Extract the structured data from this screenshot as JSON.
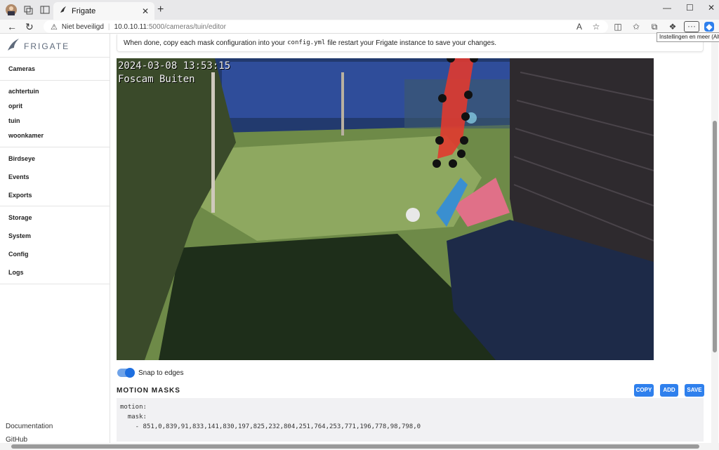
{
  "browser": {
    "tab_title": "Frigate",
    "url_warning": "Niet beveiligd",
    "url_host": "10.0.10.11",
    "url_path": ":5000/cameras/tuin/editor",
    "tooltip": "Instellingen en meer (Alt+F)"
  },
  "sidebar": {
    "brand": "FRIGATE",
    "cameras_label": "Cameras",
    "cameras": [
      "achtertuin",
      "oprit",
      "tuin",
      "woonkamer"
    ],
    "section2": [
      "Birdseye",
      "Events",
      "Exports"
    ],
    "section3": [
      "Storage",
      "System",
      "Config",
      "Logs"
    ],
    "footer": [
      "Documentation",
      "GitHub"
    ]
  },
  "main": {
    "notice_before": "When done, copy each mask configuration into your",
    "notice_code": "config.yml",
    "notice_after": "file restart your Frigate instance to save your changes.",
    "osd_timestamp": "2024-03-08 13:53:15",
    "osd_camera": "Foscam Buiten",
    "snap_label": "Snap to edges",
    "snap_enabled": true,
    "masks_title": "MOTION MASKS",
    "buttons": {
      "copy": "COPY",
      "add": "ADD",
      "save": "SAVE"
    },
    "code_line1": "motion:",
    "code_line2": "  mask:",
    "code_line3": "    - 851,0,839,91,833,141,830,197,825,232,804,251,764,253,771,196,778,98,798,0"
  },
  "colors": {
    "accent": "#2f80ed",
    "mask_fill": "#e03a2f"
  }
}
